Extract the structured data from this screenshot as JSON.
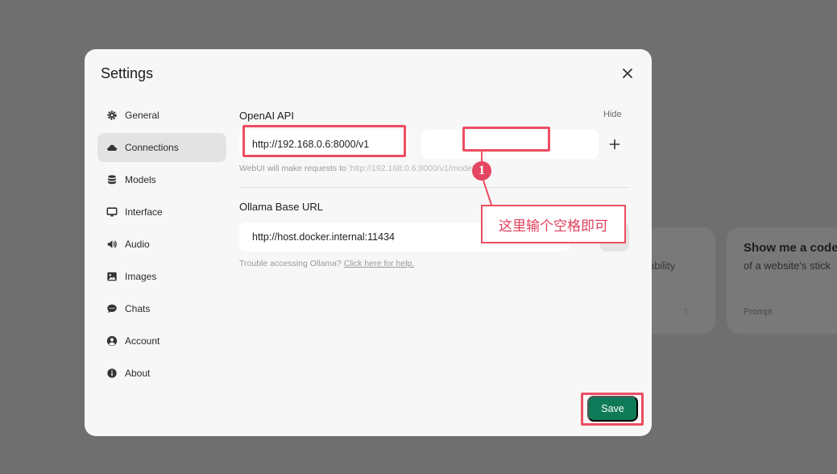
{
  "background": {
    "card_a_text": "ability",
    "card_b_title": "Show me a code",
    "card_b_subtitle": "of a website's stick",
    "card_b_label": "Prompt"
  },
  "modal": {
    "title": "Settings"
  },
  "sidebar": {
    "items": [
      {
        "label": "General",
        "icon": "gear-icon"
      },
      {
        "label": "Connections",
        "icon": "cloud-icon",
        "active": true
      },
      {
        "label": "Models",
        "icon": "database-icon"
      },
      {
        "label": "Interface",
        "icon": "monitor-icon"
      },
      {
        "label": "Audio",
        "icon": "speaker-icon"
      },
      {
        "label": "Images",
        "icon": "image-icon"
      },
      {
        "label": "Chats",
        "icon": "chat-bubble-icon"
      },
      {
        "label": "Account",
        "icon": "user-circle-icon"
      },
      {
        "label": "About",
        "icon": "info-icon"
      }
    ]
  },
  "openai": {
    "label": "OpenAI API",
    "hide_label": "Hide",
    "url_value": "http://192.168.0.6:8000/v1",
    "key_value": "",
    "hint_prefix": "WebUI will make requests to ",
    "hint_code": "'http://192.168.0.6:8000/v1/models'"
  },
  "ollama": {
    "label": "Ollama Base URL",
    "url_value": "http://host.docker.internal:11434",
    "hint_prefix": "Trouble accessing Ollama? ",
    "hint_link": "Click here for help."
  },
  "actions": {
    "save_label": "Save"
  },
  "annotation": {
    "badge_number": "1",
    "callout_text": "这里输个空格即可",
    "color": "#ec4e63"
  },
  "colors": {
    "accent": "#0f7a57",
    "annotation": "#ec4e63"
  }
}
